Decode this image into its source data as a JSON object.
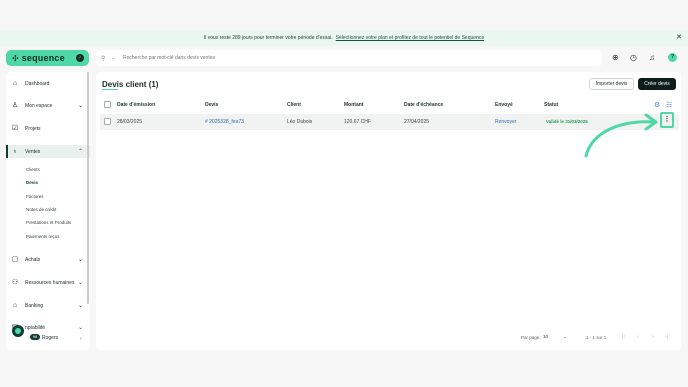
{
  "banner": {
    "message": "Il vous reste 289 jours pour terminer votre période d'essai.",
    "cta": "Sélectionnez votre plan et profitez de tout le potentiel de Sequence",
    "close_icon": "close-icon"
  },
  "brand": {
    "name": "sequence",
    "mark": "✣",
    "bubble": "✓"
  },
  "search": {
    "placeholder": "Recherche par mot-clé dans devis ventes"
  },
  "sidebar": {
    "items": [
      {
        "label": "Dashboard",
        "icon": "home-icon",
        "glyph": "⌂"
      },
      {
        "label": "Mon espace",
        "icon": "user-space-icon",
        "glyph": "♙",
        "chevron": "⌄"
      },
      {
        "label": "Projets",
        "icon": "checkbox-icon",
        "glyph": "☑"
      },
      {
        "label": "Ventes",
        "icon": "sales-bag-icon",
        "glyph": "♁",
        "chevron": "⌃"
      }
    ],
    "sub_items": [
      "Clients",
      "Devis",
      "Factures",
      "Notes de crédit",
      "Prestations et Produits",
      "Paiements reçus"
    ],
    "items_bottom": [
      {
        "label": "Achats",
        "icon": "purchase-icon",
        "glyph": "▢",
        "chevron": "⌄"
      },
      {
        "label": "Ressources humaines",
        "icon": "people-icon",
        "glyph": "⚇",
        "chevron": "⌄"
      },
      {
        "label": "Banking",
        "icon": "bank-icon",
        "glyph": "⌂",
        "chevron": "⌄"
      },
      {
        "label": "nptabilité",
        "icon": "accounting-icon",
        "glyph": "▤",
        "chevron": "⌄"
      }
    ],
    "user": {
      "name": "Rogers",
      "initials": "SR",
      "badge": "98",
      "chevron": "›"
    }
  },
  "page": {
    "title": "Devis client (1)",
    "import_button": "Importer devis",
    "create_button": "Créer devis"
  },
  "table": {
    "headers": [
      "Date d'émission",
      "Devis",
      "Client",
      "Montant",
      "Date d'échéance",
      "Envoyé",
      "Statut"
    ],
    "rows": [
      {
        "date_emission": "28/03/2025",
        "devis": "# 2025328_fea73",
        "client": "Léo Dubois",
        "montant": "120.67 CHF",
        "date_echeance": "27/04/2025",
        "envoye": "Renvoyer",
        "statut": "Validé le 31/03/2025",
        "menu": "⋮"
      }
    ]
  },
  "pagination": {
    "per_page_label": "Par page:",
    "per_page_value": "10",
    "range": "1 - 1 sur 1",
    "nav": [
      "|‹",
      "‹",
      "›",
      "›|"
    ]
  },
  "colors": {
    "accent": "#4fd8a5",
    "dark": "#0d1f1b",
    "link": "#2f6ba8",
    "success": "#1f9a52"
  }
}
